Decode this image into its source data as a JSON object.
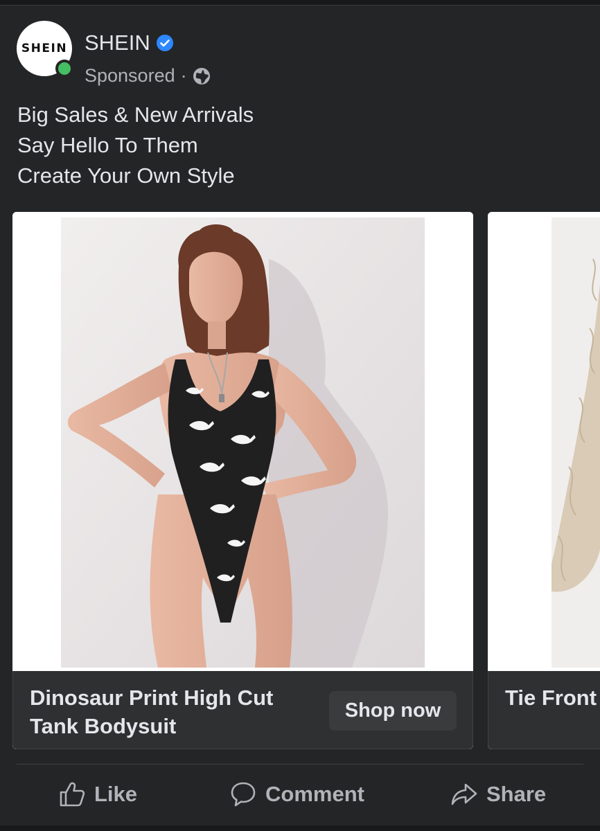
{
  "post": {
    "page_name": "SHEIN",
    "avatar_text": "SHEIN",
    "sponsored_label": "Sponsored",
    "separator": "·",
    "caption_lines": [
      "Big Sales & New Arrivals",
      "Say Hello To Them",
      "Create Your Own Style"
    ]
  },
  "carousel": [
    {
      "title": "Dinosaur Print High Cut Tank Bodysuit",
      "button_label": "Shop now"
    },
    {
      "title": "Tie Front Textured"
    }
  ],
  "actions": {
    "like": "Like",
    "comment": "Comment",
    "share": "Share"
  },
  "icons": {
    "verified": "verified-badge-icon",
    "audience": "globe-icon",
    "like": "thumbs-up-icon",
    "comment": "speech-bubble-icon",
    "share": "share-arrow-icon"
  },
  "colors": {
    "background": "#18191a",
    "card": "#242526",
    "text_primary": "#e4e6eb",
    "text_secondary": "#b0b3b8",
    "verified_blue": "#2d88ff",
    "online_green": "#45bd62"
  }
}
